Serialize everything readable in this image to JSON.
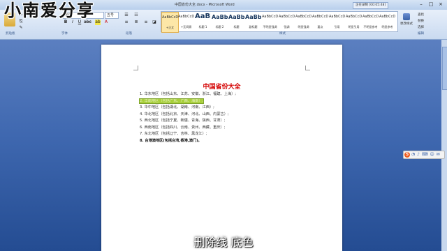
{
  "watermark": "小南爱分享",
  "window": {
    "title": "中国省份大全.docx - Microsoft Word",
    "status_badge": "正在录制 [00:05:48]"
  },
  "ribbon": {
    "font_name": "宋体",
    "font_size": "五号",
    "groups": [
      "剪贴板",
      "字体",
      "段落",
      "样式",
      "编辑"
    ],
    "styles": [
      {
        "sample": "AaBbCcDd",
        "name": "+正文",
        "kind": "small"
      },
      {
        "sample": "AaBbCcDd",
        "name": "+无间隔",
        "kind": "small"
      },
      {
        "sample": "AaBb",
        "name": "标题 1",
        "kind": "big"
      },
      {
        "sample": "AaBbC",
        "name": "标题 2",
        "kind": "mid"
      },
      {
        "sample": "AaBbC",
        "name": "标题",
        "kind": "mid"
      },
      {
        "sample": "AaBbC",
        "name": "副标题",
        "kind": "mid"
      },
      {
        "sample": "AaBbCcDd",
        "name": "不明显强调",
        "kind": "small"
      },
      {
        "sample": "AaBbCcDd",
        "name": "强调",
        "kind": "small"
      },
      {
        "sample": "AaBbCcDd",
        "name": "明显强调",
        "kind": "small"
      },
      {
        "sample": "AaBbCcDd",
        "name": "要点",
        "kind": "small"
      },
      {
        "sample": "AaBbCcDd",
        "name": "引用",
        "kind": "small"
      },
      {
        "sample": "AaBbCcDd",
        "name": "明显引用",
        "kind": "small"
      },
      {
        "sample": "AaBbCcDd",
        "name": "不明显参考",
        "kind": "small"
      },
      {
        "sample": "AaBbCcDd",
        "name": "明显参考",
        "kind": "small"
      }
    ],
    "change_styles": "更改样式",
    "editing": [
      "查找",
      "替换",
      "选择"
    ]
  },
  "document": {
    "title": "中国省份大全",
    "items": [
      {
        "text": "1.  华东地区（包括山东、江苏、安徽、浙江、福建、上海）;",
        "highlighted": false,
        "bold": false
      },
      {
        "text": "2.  华南地区（包括广东、广西、海南）;",
        "highlighted": true,
        "bold": false
      },
      {
        "text": "3.  华中地区（包括湖北、湖南、河南、江西）;",
        "highlighted": false,
        "bold": false
      },
      {
        "text": "4.  华北地区（包括北京、天津、河北、山西、内蒙古）;",
        "highlighted": false,
        "bold": false
      },
      {
        "text": "5.  西北地区（包括宁夏、新疆、青海、陕西、甘肃）;",
        "highlighted": false,
        "bold": false
      },
      {
        "text": "6.  西南地区（包括四川、云南、贵州、西藏、重庆）;",
        "highlighted": false,
        "bold": false
      },
      {
        "text": "7.  东北地区（包括辽宁、吉林、黑龙江）;",
        "highlighted": false,
        "bold": false
      },
      {
        "text": "8. 台港澳地区(包括台湾,香港,澳门)。",
        "highlighted": false,
        "bold": true
      }
    ]
  },
  "ime": {
    "logo": "S"
  },
  "subtitle": "删除线  底色",
  "colors": {
    "title_red": "#d40000",
    "highlight": "#a8cf3b",
    "workspace": "#3f68b0"
  }
}
